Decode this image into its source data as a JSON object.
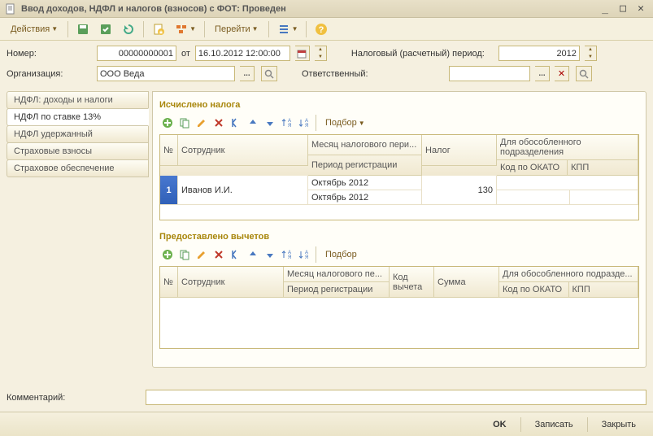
{
  "window": {
    "title": "Ввод доходов, НДФЛ и налогов (взносов) с ФОТ: Проведен"
  },
  "toolbar": {
    "actions": "Действия",
    "goto": "Перейти"
  },
  "form": {
    "number_label": "Номер:",
    "number_value": "00000000001",
    "from_label": "от",
    "date_value": "16.10.2012 12:00:00",
    "org_label": "Организация:",
    "org_value": "ООО Веда",
    "tax_period_label": "Налоговый (расчетный) период:",
    "tax_period_value": "2012",
    "resp_label": "Ответственный:",
    "resp_value": ""
  },
  "tabs": [
    "НДФЛ: доходы и налоги",
    "НДФЛ по ставке 13%",
    "НДФЛ удержанный",
    "Страховые взносы",
    "Страховое обеспечение"
  ],
  "section1": {
    "title": "Исчислено налога",
    "select_label": "Подбор",
    "headers": {
      "num": "№",
      "employee": "Сотрудник",
      "month": "Месяц налогового пери...",
      "reg_period": "Период регистрации",
      "tax": "Налог",
      "subdiv": "Для обособленного подразделения",
      "okato": "Код по ОКАТО",
      "kpp": "КПП"
    },
    "rows": [
      {
        "n": "1",
        "employee": "Иванов И.И.",
        "month": "Октябрь 2012",
        "reg": "Октябрь 2012",
        "tax": "130"
      }
    ]
  },
  "section2": {
    "title": "Предоставлено вычетов",
    "select_label": "Подбор",
    "headers": {
      "num": "№",
      "employee": "Сотрудник",
      "month": "Месяц налогового пе...",
      "reg_period": "Период регистрации",
      "deduct_code": "Код вычета",
      "sum": "Сумма",
      "subdiv": "Для обособленного подразде...",
      "okato": "Код по ОКАТО",
      "kpp": "КПП"
    }
  },
  "comment_label": "Комментарий:",
  "buttons": {
    "ok": "OK",
    "save": "Записать",
    "close": "Закрыть"
  }
}
